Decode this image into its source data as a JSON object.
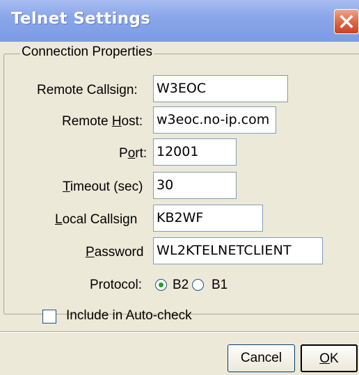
{
  "window": {
    "title": "Telnet Settings"
  },
  "group": {
    "legend": "Connection Properties"
  },
  "form": {
    "remote_callsign": {
      "label": "Remote Callsign:",
      "value": "W3EOC"
    },
    "remote_host": {
      "label_pre": "Remote ",
      "label_key": "H",
      "label_post": "ost:",
      "value": "w3eoc.no-ip.com"
    },
    "port": {
      "label_pre": "P",
      "label_key": "o",
      "label_post": "rt:",
      "value": "12001"
    },
    "timeout": {
      "label_key": "T",
      "label_post": "imeout (sec)",
      "value": "30"
    },
    "local_callsign": {
      "label_key": "L",
      "label_post": "ocal Callsign",
      "value": "KB2WF"
    },
    "password": {
      "label_key": "P",
      "label_post": "assword",
      "value": "WL2KTELNETCLIENT"
    },
    "protocol": {
      "label": "Protocol:",
      "options": [
        "B2",
        "B1"
      ],
      "selected": "B2"
    },
    "auto_check": {
      "label": "Include in Auto-check",
      "checked": false
    }
  },
  "buttons": {
    "cancel": "Cancel",
    "ok_key": "O",
    "ok_post": "K"
  }
}
